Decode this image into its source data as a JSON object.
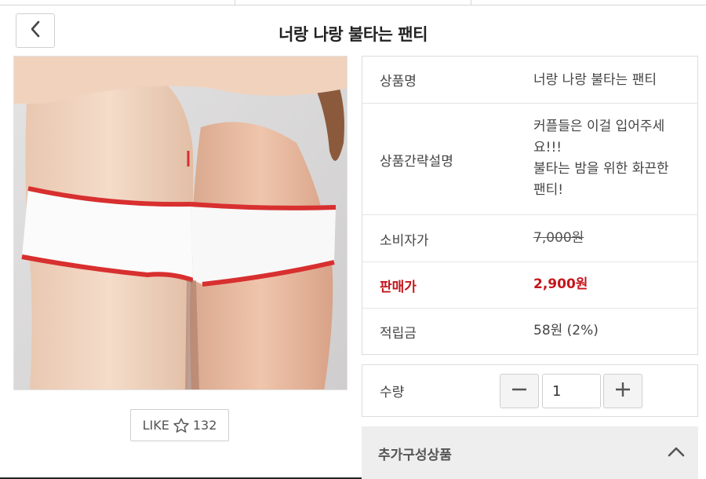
{
  "header": {
    "title": "너랑 나랑 불타는 팬티",
    "back_icon": "chevron-left-icon"
  },
  "product": {
    "like_label": "LIKE",
    "like_icon": "star-icon",
    "like_count": "132"
  },
  "info": {
    "name_label": "상품명",
    "name_value": "너랑 나랑 불타는 팬티",
    "desc_label": "상품간략설명",
    "desc_lines": [
      "커플들은 이걸 입어주세",
      "요!!!",
      "불타는 밤을 위한 화끈한",
      "팬티!"
    ],
    "msrp_label": "소비자가",
    "msrp_value": "7,000원",
    "price_label": "판매가",
    "price_value": "2,900원",
    "points_label": "적립금",
    "points_value": "58원 (2%)"
  },
  "quantity": {
    "label": "수량",
    "value": "1",
    "minus_icon": "minus-icon",
    "plus_icon": "plus-icon"
  },
  "addon": {
    "label": "추가구성상품",
    "toggle_icon": "chevron-up-icon"
  },
  "colors": {
    "price_red": "#c4161c",
    "border": "#dcdcdc"
  }
}
